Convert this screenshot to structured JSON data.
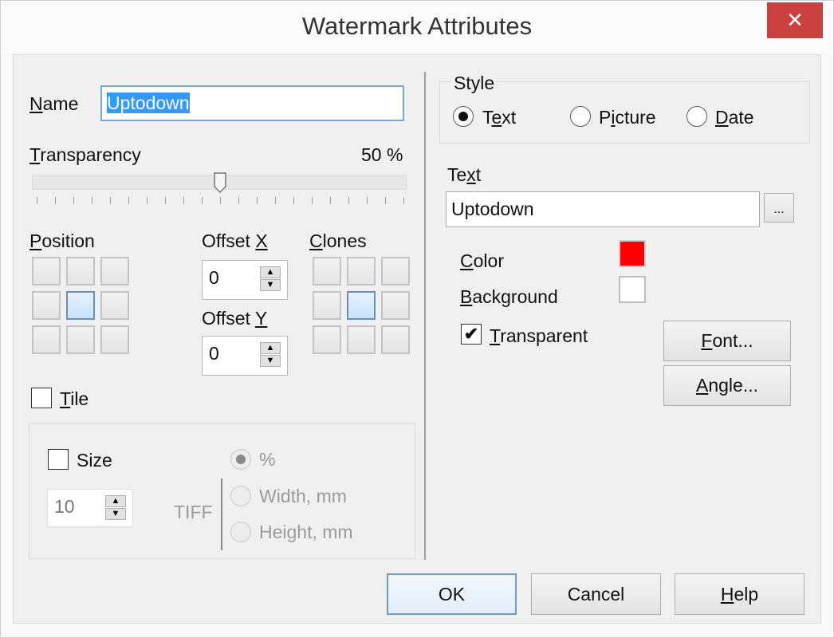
{
  "window": {
    "title": "Watermark Attributes",
    "close_label": "X"
  },
  "left": {
    "name_label": "Name",
    "name_value": "Uptodown",
    "transparency_label": "Transparency",
    "transparency_value_text": "50 %",
    "transparency_percent": 50,
    "slider_tick_count": 21,
    "position_label": "Position",
    "position_selected": "center",
    "offset_x_label": "Offset X",
    "offset_x_value": "0",
    "offset_y_label": "Offset Y",
    "offset_y_value": "0",
    "clones_label": "Clones",
    "clones_selected": "center",
    "tile_label": "Tile",
    "tile_checked": false,
    "size_group": {
      "size_label": "Size",
      "size_checked": false,
      "size_value": "10",
      "tiff_label": "TIFF",
      "units": [
        {
          "label": "%",
          "selected": true
        },
        {
          "label": "Width, mm",
          "selected": false
        },
        {
          "label": "Height, mm",
          "selected": false
        }
      ]
    }
  },
  "right": {
    "style_group_label": "Style",
    "style_options": [
      {
        "label": "Text",
        "selected": true
      },
      {
        "label": "Picture",
        "selected": false
      },
      {
        "label": "Date",
        "selected": false
      }
    ],
    "text_label": "Text",
    "text_value": "Uptodown",
    "browse_label": "...",
    "color_label": "Color",
    "color_value": "#ff0000",
    "background_label": "Background",
    "background_value": "#ffffff",
    "transparent_label": "Transparent",
    "transparent_checked": true,
    "font_button": "Font...",
    "angle_button": "Angle..."
  },
  "footer": {
    "ok": "OK",
    "cancel": "Cancel",
    "help": "Help"
  },
  "icons": {
    "check": "✔",
    "up": "▲",
    "down": "▼",
    "close": "✕"
  }
}
